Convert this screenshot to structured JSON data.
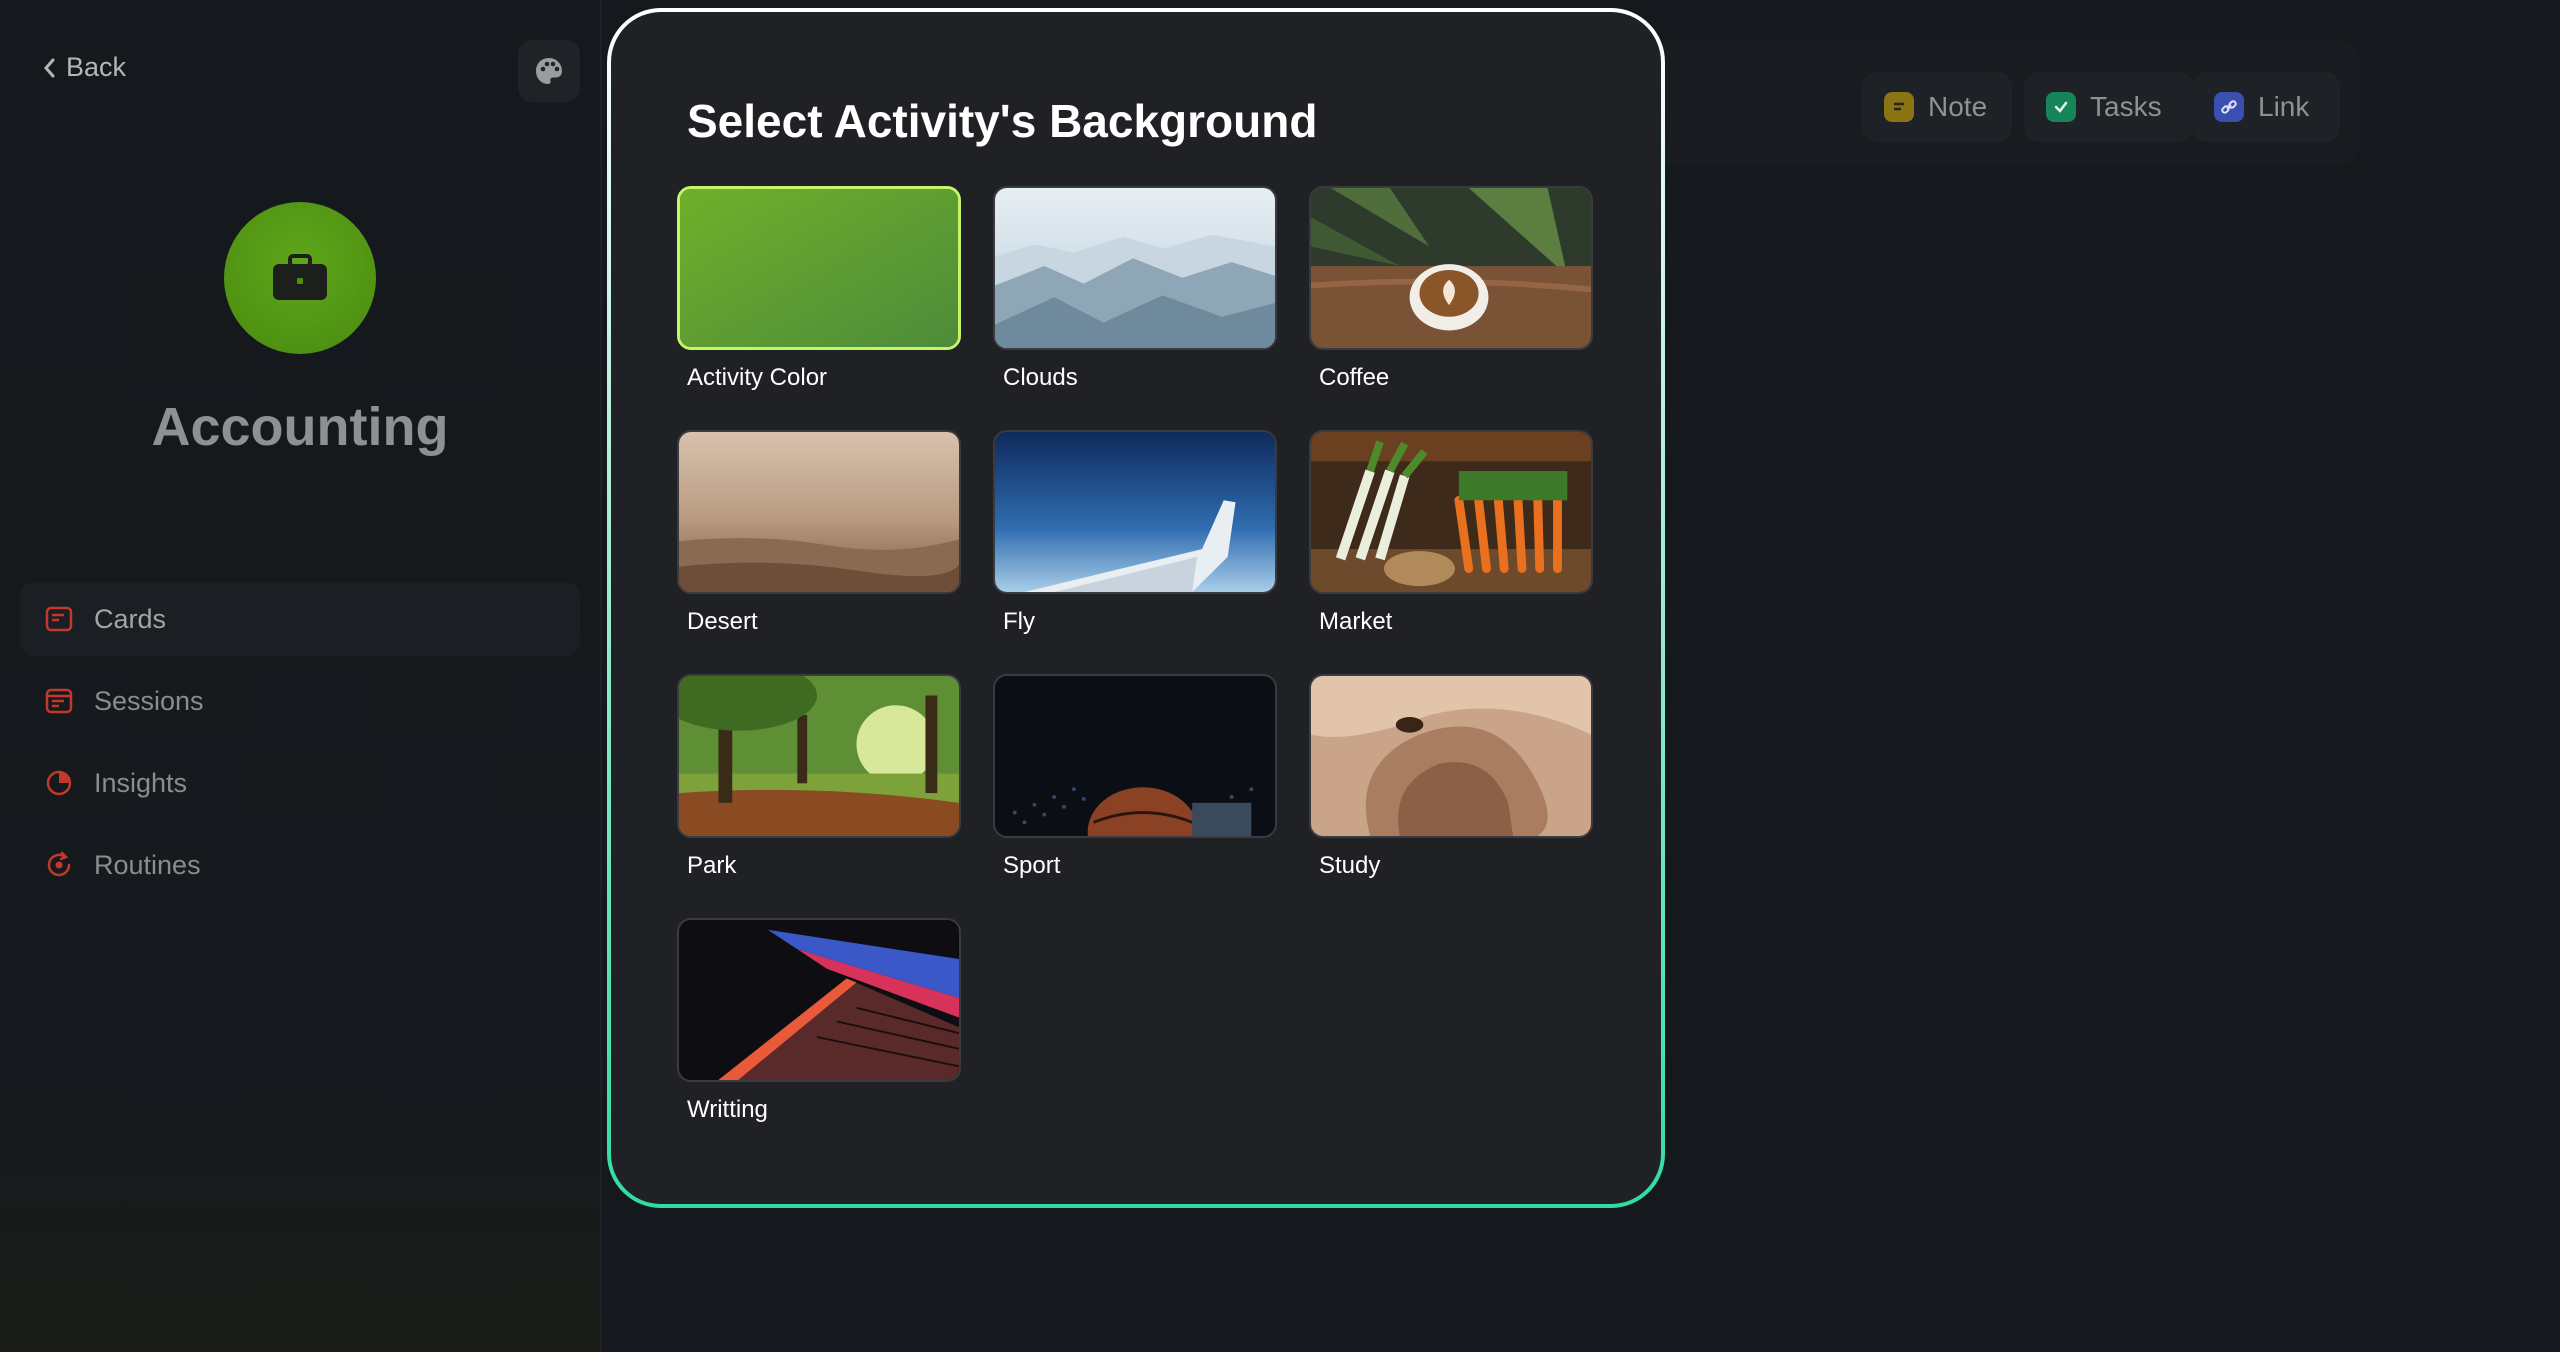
{
  "sidebar": {
    "back_label": "Back",
    "activity_name": "Accounting",
    "accent_color": "#4f8f12",
    "nav": [
      {
        "label": "Cards",
        "icon": "cards-icon",
        "active": true
      },
      {
        "label": "Sessions",
        "icon": "sessions-icon",
        "active": false
      },
      {
        "label": "Insights",
        "icon": "insights-icon",
        "active": false
      },
      {
        "label": "Routines",
        "icon": "routines-icon",
        "active": false
      }
    ]
  },
  "toolbar": {
    "note_label": "Note",
    "tasks_label": "Tasks",
    "link_label": "Link"
  },
  "modal": {
    "title": "Select Activity's Background",
    "selected": "Activity Color",
    "backgrounds": [
      {
        "label": "Activity Color"
      },
      {
        "label": "Clouds"
      },
      {
        "label": "Coffee"
      },
      {
        "label": "Desert"
      },
      {
        "label": "Fly"
      },
      {
        "label": "Market"
      },
      {
        "label": "Park"
      },
      {
        "label": "Sport"
      },
      {
        "label": "Study"
      },
      {
        "label": "Writting"
      }
    ]
  }
}
